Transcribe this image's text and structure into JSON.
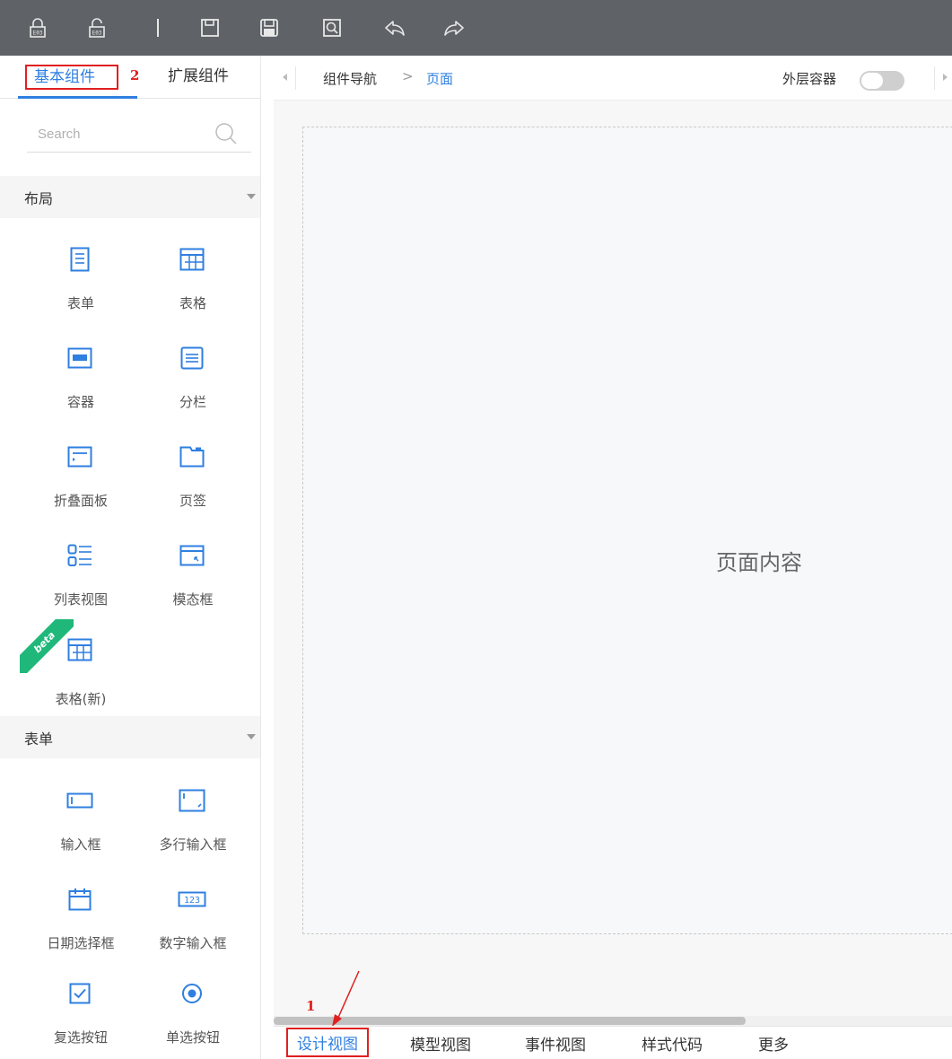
{
  "toolbar": {
    "icons": [
      "lock-icon",
      "unlock-icon",
      "separator-icon",
      "save-icon",
      "save-as-icon",
      "preview-icon",
      "undo-icon",
      "redo-icon"
    ]
  },
  "left_panel": {
    "tabs": [
      {
        "label": "基本组件",
        "active": true
      },
      {
        "label": "扩展组件",
        "active": false
      }
    ],
    "annotation_tab": "2",
    "search": {
      "placeholder": "Search"
    },
    "sections": [
      {
        "title": "布局",
        "items": [
          {
            "label": "表单",
            "icon": "form-icon"
          },
          {
            "label": "表格",
            "icon": "table-icon"
          },
          {
            "label": "容器",
            "icon": "container-icon"
          },
          {
            "label": "分栏",
            "icon": "columns-icon"
          },
          {
            "label": "折叠面板",
            "icon": "collapse-panel-icon"
          },
          {
            "label": "页签",
            "icon": "tabs-icon"
          },
          {
            "label": "列表视图",
            "icon": "list-view-icon"
          },
          {
            "label": "模态框",
            "icon": "modal-icon"
          },
          {
            "label": "表格(新)",
            "icon": "table-new-icon",
            "badge": "beta"
          }
        ]
      },
      {
        "title": "表单",
        "items": [
          {
            "label": "输入框",
            "icon": "input-icon"
          },
          {
            "label": "多行输入框",
            "icon": "textarea-icon"
          },
          {
            "label": "日期选择框",
            "icon": "date-picker-icon"
          },
          {
            "label": "数字输入框",
            "icon": "number-input-icon"
          },
          {
            "label": "复选按钮",
            "icon": "checkbox-icon"
          },
          {
            "label": "单选按钮",
            "icon": "radio-icon"
          }
        ]
      }
    ]
  },
  "breadcrumb": {
    "root": "组件导航",
    "separator": ">",
    "current": "页面"
  },
  "outer_container": {
    "label": "外层容器",
    "enabled": false
  },
  "canvas": {
    "page_content": "页面内容"
  },
  "bottom_tabs": {
    "annotation": "1",
    "tabs": [
      {
        "label": "设计视图",
        "active": true
      },
      {
        "label": "模型视图",
        "active": false
      },
      {
        "label": "事件视图",
        "active": false
      },
      {
        "label": "样式代码",
        "active": false
      },
      {
        "label": "更多",
        "active": false
      }
    ]
  },
  "colors": {
    "toolbar_bg": "#5f6266",
    "accent": "#2f7fe0",
    "annotation_red": "#e02020",
    "beta_green": "#1fb87a"
  }
}
